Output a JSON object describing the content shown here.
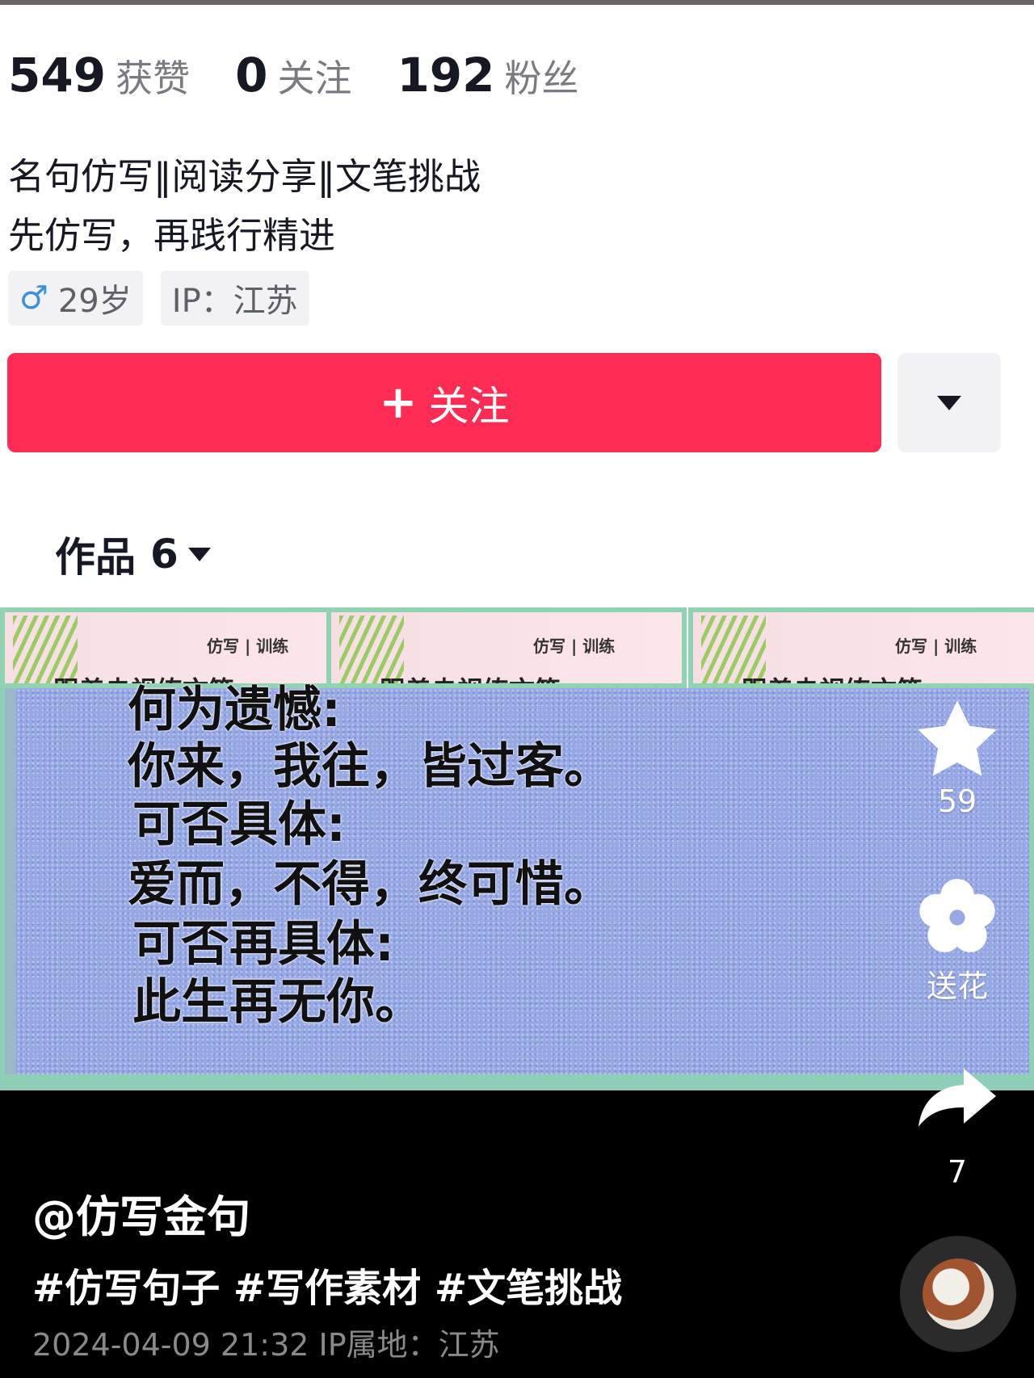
{
  "profile": {
    "stats": [
      {
        "value": "549",
        "label": "获赞"
      },
      {
        "value": "0",
        "label": "关注"
      },
      {
        "value": "192",
        "label": "粉丝"
      }
    ],
    "bio_line1": "名句仿写‖阅读分享‖文笔挑战",
    "bio_line2": "先仿写，再践行精进",
    "tags": {
      "gender_icon": "♂",
      "age": "29岁",
      "ip": "IP：江苏"
    },
    "follow_button": {
      "plus": "+",
      "label": "关注"
    },
    "more_button_icon": "caret-down-icon",
    "works": {
      "label": "作品",
      "count": "6"
    }
  },
  "thumbnails": [
    {
      "tag": "仿写 | 训练",
      "title": "跟着央视练文笔"
    },
    {
      "tag": "仿写 | 训练",
      "title": "跟着央视练文笔"
    },
    {
      "tag": "仿写 | 训练",
      "title": "跟着央视练文笔"
    }
  ],
  "video": {
    "poem_lines": [
      "何为遗憾:",
      "你来，我往，皆过客。",
      "可否具体:",
      "爱而，不得，终可惜。",
      "可否再具体:",
      "此生再无你。"
    ],
    "actions": {
      "favorite_count": "59",
      "gift_label": "送花",
      "share_count": "7"
    },
    "author": "@仿写金句",
    "hashtags": "#仿写句子 #写作素材 #文笔挑战",
    "meta": "2024-04-09 21:32  IP属地：江苏"
  },
  "colors": {
    "accent": "#fe2c55",
    "frame_border": "#8fcfb6",
    "frame_bg": "#97a9e4"
  }
}
